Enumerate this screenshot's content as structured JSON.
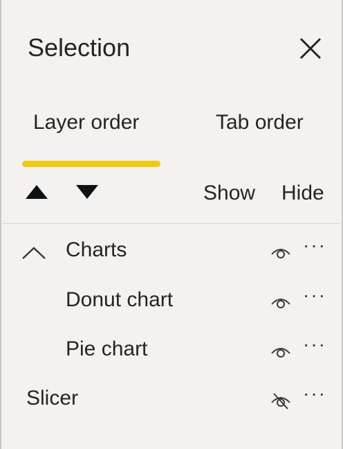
{
  "header": {
    "title": "Selection",
    "close_icon": "close-icon"
  },
  "tabs": [
    {
      "label": "Layer order",
      "active": true
    },
    {
      "label": "Tab order",
      "active": false
    }
  ],
  "accent_color": "#f2c811",
  "toolbar": {
    "move_up_icon": "triangle-up-icon",
    "move_down_icon": "triangle-down-icon",
    "show_label": "Show",
    "hide_label": "Hide"
  },
  "layers": [
    {
      "label": "Charts",
      "type": "group",
      "expanded": true,
      "visible": true,
      "more": "···"
    },
    {
      "label": "Donut chart",
      "type": "child",
      "visible": true,
      "more": "···"
    },
    {
      "label": "Pie chart",
      "type": "child",
      "visible": true,
      "more": "···"
    },
    {
      "label": "Slicer",
      "type": "item",
      "visible": false,
      "more": "···"
    }
  ]
}
